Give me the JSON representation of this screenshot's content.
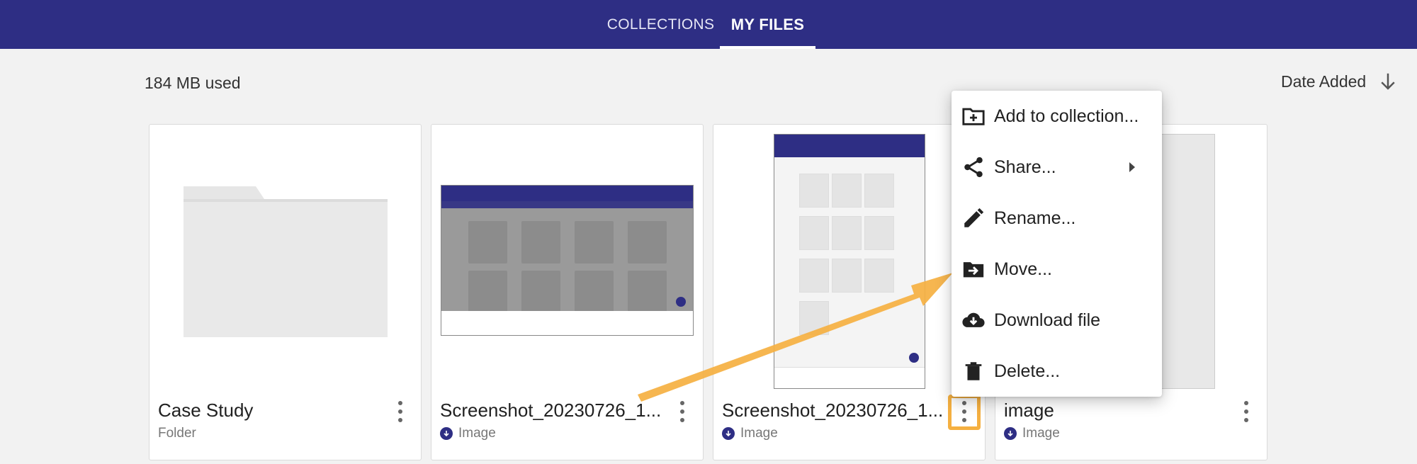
{
  "tabs": [
    {
      "label": "COLLECTIONS",
      "active": false
    },
    {
      "label": "MY FILES",
      "active": true
    }
  ],
  "usage_text": "184 MB used",
  "sort": {
    "label": "Date Added",
    "icon": "arrow-down-icon"
  },
  "cards": [
    {
      "title": "Case Study",
      "subtitle": "Folder",
      "type": "folder"
    },
    {
      "title": "Screenshot_20230726_1...",
      "subtitle": "Image",
      "type": "image"
    },
    {
      "title": "Screenshot_20230726_1...",
      "subtitle": "Image",
      "type": "image"
    },
    {
      "title": "image",
      "subtitle": "Image",
      "type": "image"
    }
  ],
  "context_menu": [
    {
      "label": "Add to collection...",
      "icon": "add-to-folder-icon"
    },
    {
      "label": "Share...",
      "icon": "share-icon",
      "has_submenu": true
    },
    {
      "label": "Rename...",
      "icon": "pencil-icon"
    },
    {
      "label": "Move...",
      "icon": "move-folder-icon"
    },
    {
      "label": "Download file",
      "icon": "cloud-download-icon"
    },
    {
      "label": "Delete...",
      "icon": "trash-icon"
    }
  ],
  "colors": {
    "header": "#2e2e84",
    "highlight": "#f5b041",
    "annotation_arrow": "#f5b041"
  }
}
